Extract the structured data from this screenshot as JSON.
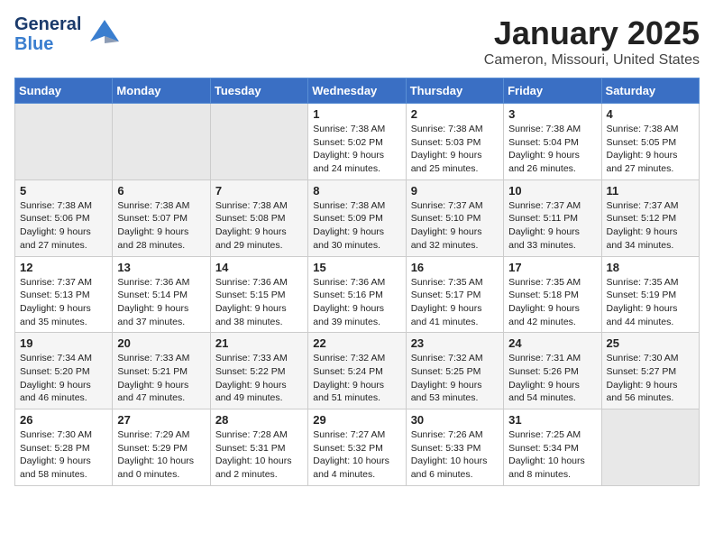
{
  "header": {
    "logo_line1": "General",
    "logo_line2": "Blue",
    "title": "January 2025",
    "subtitle": "Cameron, Missouri, United States"
  },
  "weekdays": [
    "Sunday",
    "Monday",
    "Tuesday",
    "Wednesday",
    "Thursday",
    "Friday",
    "Saturday"
  ],
  "weeks": [
    {
      "shade": "white",
      "days": [
        {
          "num": "",
          "info": ""
        },
        {
          "num": "",
          "info": ""
        },
        {
          "num": "",
          "info": ""
        },
        {
          "num": "1",
          "info": "Sunrise: 7:38 AM\nSunset: 5:02 PM\nDaylight: 9 hours\nand 24 minutes."
        },
        {
          "num": "2",
          "info": "Sunrise: 7:38 AM\nSunset: 5:03 PM\nDaylight: 9 hours\nand 25 minutes."
        },
        {
          "num": "3",
          "info": "Sunrise: 7:38 AM\nSunset: 5:04 PM\nDaylight: 9 hours\nand 26 minutes."
        },
        {
          "num": "4",
          "info": "Sunrise: 7:38 AM\nSunset: 5:05 PM\nDaylight: 9 hours\nand 27 minutes."
        }
      ]
    },
    {
      "shade": "gray",
      "days": [
        {
          "num": "5",
          "info": "Sunrise: 7:38 AM\nSunset: 5:06 PM\nDaylight: 9 hours\nand 27 minutes."
        },
        {
          "num": "6",
          "info": "Sunrise: 7:38 AM\nSunset: 5:07 PM\nDaylight: 9 hours\nand 28 minutes."
        },
        {
          "num": "7",
          "info": "Sunrise: 7:38 AM\nSunset: 5:08 PM\nDaylight: 9 hours\nand 29 minutes."
        },
        {
          "num": "8",
          "info": "Sunrise: 7:38 AM\nSunset: 5:09 PM\nDaylight: 9 hours\nand 30 minutes."
        },
        {
          "num": "9",
          "info": "Sunrise: 7:37 AM\nSunset: 5:10 PM\nDaylight: 9 hours\nand 32 minutes."
        },
        {
          "num": "10",
          "info": "Sunrise: 7:37 AM\nSunset: 5:11 PM\nDaylight: 9 hours\nand 33 minutes."
        },
        {
          "num": "11",
          "info": "Sunrise: 7:37 AM\nSunset: 5:12 PM\nDaylight: 9 hours\nand 34 minutes."
        }
      ]
    },
    {
      "shade": "white",
      "days": [
        {
          "num": "12",
          "info": "Sunrise: 7:37 AM\nSunset: 5:13 PM\nDaylight: 9 hours\nand 35 minutes."
        },
        {
          "num": "13",
          "info": "Sunrise: 7:36 AM\nSunset: 5:14 PM\nDaylight: 9 hours\nand 37 minutes."
        },
        {
          "num": "14",
          "info": "Sunrise: 7:36 AM\nSunset: 5:15 PM\nDaylight: 9 hours\nand 38 minutes."
        },
        {
          "num": "15",
          "info": "Sunrise: 7:36 AM\nSunset: 5:16 PM\nDaylight: 9 hours\nand 39 minutes."
        },
        {
          "num": "16",
          "info": "Sunrise: 7:35 AM\nSunset: 5:17 PM\nDaylight: 9 hours\nand 41 minutes."
        },
        {
          "num": "17",
          "info": "Sunrise: 7:35 AM\nSunset: 5:18 PM\nDaylight: 9 hours\nand 42 minutes."
        },
        {
          "num": "18",
          "info": "Sunrise: 7:35 AM\nSunset: 5:19 PM\nDaylight: 9 hours\nand 44 minutes."
        }
      ]
    },
    {
      "shade": "gray",
      "days": [
        {
          "num": "19",
          "info": "Sunrise: 7:34 AM\nSunset: 5:20 PM\nDaylight: 9 hours\nand 46 minutes."
        },
        {
          "num": "20",
          "info": "Sunrise: 7:33 AM\nSunset: 5:21 PM\nDaylight: 9 hours\nand 47 minutes."
        },
        {
          "num": "21",
          "info": "Sunrise: 7:33 AM\nSunset: 5:22 PM\nDaylight: 9 hours\nand 49 minutes."
        },
        {
          "num": "22",
          "info": "Sunrise: 7:32 AM\nSunset: 5:24 PM\nDaylight: 9 hours\nand 51 minutes."
        },
        {
          "num": "23",
          "info": "Sunrise: 7:32 AM\nSunset: 5:25 PM\nDaylight: 9 hours\nand 53 minutes."
        },
        {
          "num": "24",
          "info": "Sunrise: 7:31 AM\nSunset: 5:26 PM\nDaylight: 9 hours\nand 54 minutes."
        },
        {
          "num": "25",
          "info": "Sunrise: 7:30 AM\nSunset: 5:27 PM\nDaylight: 9 hours\nand 56 minutes."
        }
      ]
    },
    {
      "shade": "white",
      "days": [
        {
          "num": "26",
          "info": "Sunrise: 7:30 AM\nSunset: 5:28 PM\nDaylight: 9 hours\nand 58 minutes."
        },
        {
          "num": "27",
          "info": "Sunrise: 7:29 AM\nSunset: 5:29 PM\nDaylight: 10 hours\nand 0 minutes."
        },
        {
          "num": "28",
          "info": "Sunrise: 7:28 AM\nSunset: 5:31 PM\nDaylight: 10 hours\nand 2 minutes."
        },
        {
          "num": "29",
          "info": "Sunrise: 7:27 AM\nSunset: 5:32 PM\nDaylight: 10 hours\nand 4 minutes."
        },
        {
          "num": "30",
          "info": "Sunrise: 7:26 AM\nSunset: 5:33 PM\nDaylight: 10 hours\nand 6 minutes."
        },
        {
          "num": "31",
          "info": "Sunrise: 7:25 AM\nSunset: 5:34 PM\nDaylight: 10 hours\nand 8 minutes."
        },
        {
          "num": "",
          "info": ""
        }
      ]
    }
  ]
}
